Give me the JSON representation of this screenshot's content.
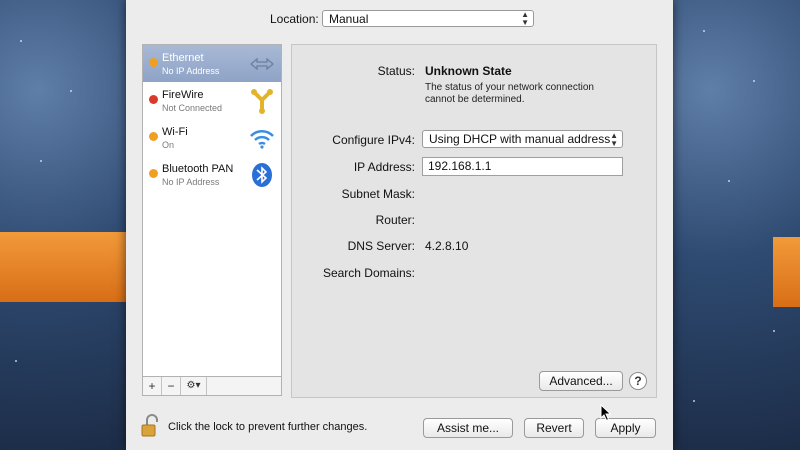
{
  "location": {
    "label": "Location:",
    "value": "Manual"
  },
  "services": [
    {
      "name": "Ethernet",
      "status": "No IP Address",
      "status_color": "#f0a020",
      "icon": "ethernet-arrows-icon",
      "selected": true
    },
    {
      "name": "FireWire",
      "status": "Not Connected",
      "status_color": "#d93a2c",
      "icon": "firewire-icon",
      "selected": false
    },
    {
      "name": "Wi-Fi",
      "status": "On",
      "status_color": "#f0a020",
      "icon": "wifi-icon",
      "selected": false
    },
    {
      "name": "Bluetooth PAN",
      "status": "No IP Address",
      "status_color": "#f0a020",
      "icon": "bluetooth-icon",
      "selected": false
    }
  ],
  "sidebar_toolbar": {
    "add": "+",
    "remove": "−",
    "gear": "⚙▾"
  },
  "details": {
    "status_label": "Status:",
    "status_value": "Unknown State",
    "status_description": "The status of your network connection cannot be determined.",
    "configure_label": "Configure IPv4:",
    "configure_value": "Using DHCP with manual address",
    "ip_label": "IP Address:",
    "ip_value": "192.168.1.1",
    "subnet_label": "Subnet Mask:",
    "router_label": "Router:",
    "dns_label": "DNS Server:",
    "dns_value": "4.2.8.10",
    "search_label": "Search Domains:"
  },
  "buttons": {
    "advanced": "Advanced...",
    "help": "?",
    "assist": "Assist me...",
    "revert": "Revert",
    "apply": "Apply"
  },
  "lock_text": "Click the lock to prevent further changes."
}
